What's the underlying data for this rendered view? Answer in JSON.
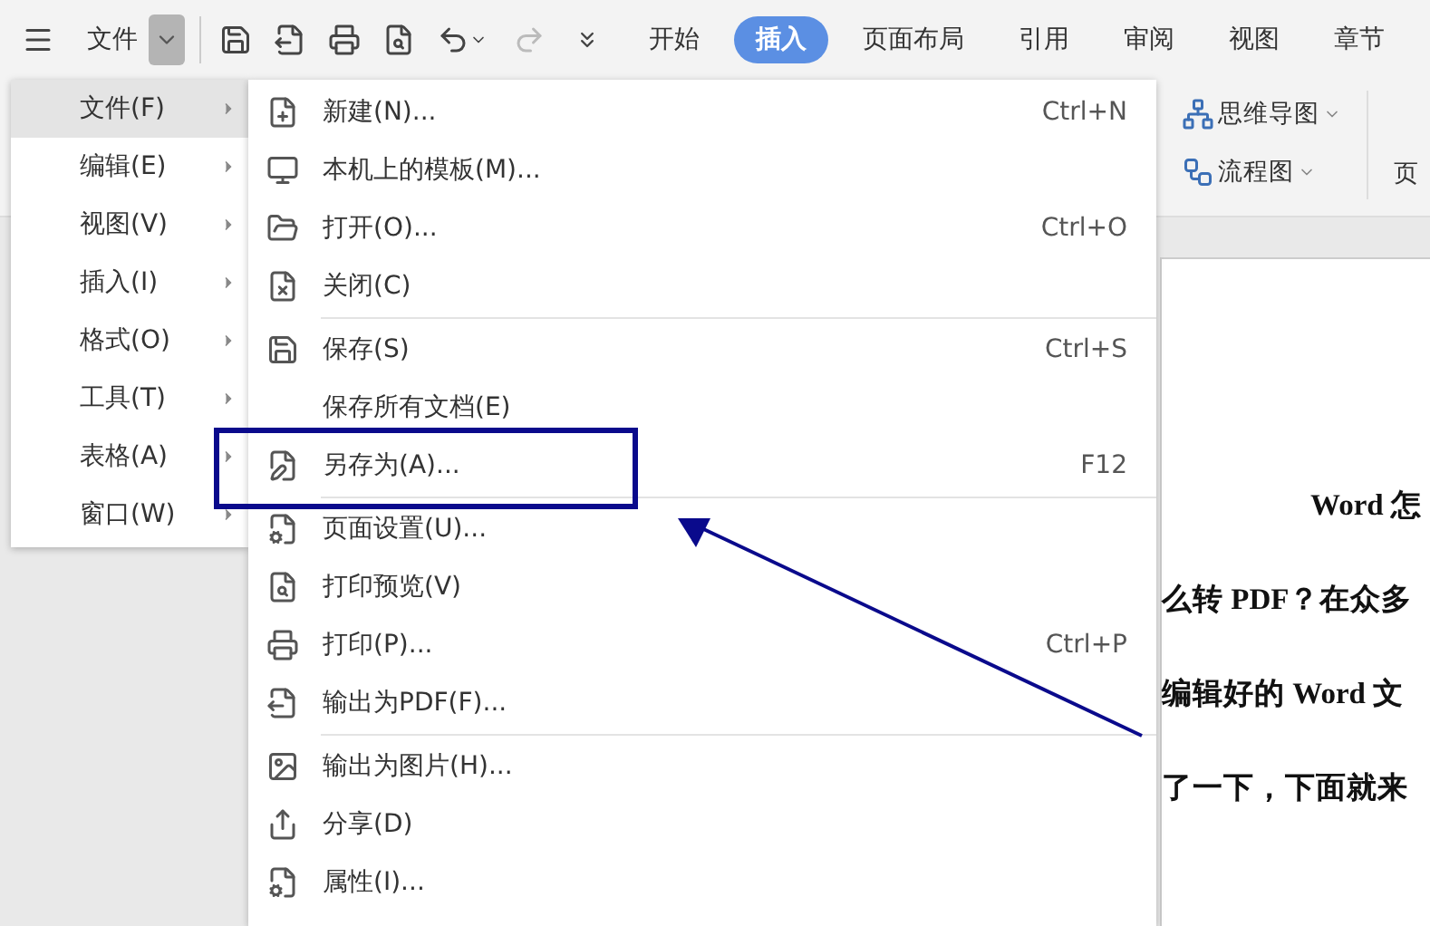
{
  "toolbar": {
    "menu_label": "文件",
    "tabs": [
      {
        "label": "开始",
        "selected": false
      },
      {
        "label": "插入",
        "selected": true
      },
      {
        "label": "页面布局",
        "selected": false
      },
      {
        "label": "引用",
        "selected": false
      },
      {
        "label": "审阅",
        "selected": false
      },
      {
        "label": "视图",
        "selected": false
      },
      {
        "label": "章节",
        "selected": false
      }
    ]
  },
  "ribbon": {
    "tools": [
      {
        "label": "思维导图"
      },
      {
        "label": "流程图"
      }
    ],
    "cut_label": "页"
  },
  "menu": {
    "items": [
      {
        "label": "文件(F)",
        "selected": true
      },
      {
        "label": "编辑(E)",
        "selected": false
      },
      {
        "label": "视图(V)",
        "selected": false
      },
      {
        "label": "插入(I)",
        "selected": false
      },
      {
        "label": "格式(O)",
        "selected": false
      },
      {
        "label": "工具(T)",
        "selected": false
      },
      {
        "label": "表格(A)",
        "selected": false
      },
      {
        "label": "窗口(W)",
        "selected": false
      }
    ]
  },
  "submenu": {
    "groups": [
      [
        {
          "label": "新建(N)...",
          "shortcut": "Ctrl+N"
        },
        {
          "label": "本机上的模板(M)..."
        },
        {
          "label": "打开(O)...",
          "shortcut": "Ctrl+O"
        },
        {
          "label": "关闭(C)"
        }
      ],
      [
        {
          "label": "保存(S)",
          "shortcut": "Ctrl+S"
        },
        {
          "label": "保存所有文档(E)"
        },
        {
          "label": "另存为(A)...",
          "shortcut": "F12",
          "highlighted": true
        }
      ],
      [
        {
          "label": "页面设置(U)..."
        },
        {
          "label": "打印预览(V)"
        },
        {
          "label": "打印(P)...",
          "shortcut": "Ctrl+P"
        },
        {
          "label": "输出为PDF(F)..."
        }
      ],
      [
        {
          "label": "输出为图片(H)..."
        },
        {
          "label": "分享(D)"
        },
        {
          "label": "属性(I)..."
        }
      ]
    ]
  },
  "document": {
    "title": "Word 怎",
    "lines": [
      "么转 PDF？在众多",
      "编辑好的 Word 文",
      "了一下，下面就来"
    ]
  }
}
